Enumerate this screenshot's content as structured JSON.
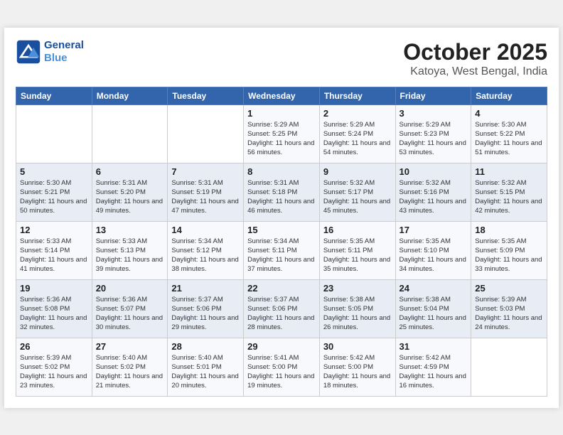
{
  "header": {
    "logo_line1": "General",
    "logo_line2": "Blue",
    "month": "October 2025",
    "location": "Katoya, West Bengal, India"
  },
  "weekdays": [
    "Sunday",
    "Monday",
    "Tuesday",
    "Wednesday",
    "Thursday",
    "Friday",
    "Saturday"
  ],
  "weeks": [
    [
      {
        "day": "",
        "info": ""
      },
      {
        "day": "",
        "info": ""
      },
      {
        "day": "",
        "info": ""
      },
      {
        "day": "1",
        "info": "Sunrise: 5:29 AM\nSunset: 5:25 PM\nDaylight: 11 hours\nand 56 minutes."
      },
      {
        "day": "2",
        "info": "Sunrise: 5:29 AM\nSunset: 5:24 PM\nDaylight: 11 hours\nand 54 minutes."
      },
      {
        "day": "3",
        "info": "Sunrise: 5:29 AM\nSunset: 5:23 PM\nDaylight: 11 hours\nand 53 minutes."
      },
      {
        "day": "4",
        "info": "Sunrise: 5:30 AM\nSunset: 5:22 PM\nDaylight: 11 hours\nand 51 minutes."
      }
    ],
    [
      {
        "day": "5",
        "info": "Sunrise: 5:30 AM\nSunset: 5:21 PM\nDaylight: 11 hours\nand 50 minutes."
      },
      {
        "day": "6",
        "info": "Sunrise: 5:31 AM\nSunset: 5:20 PM\nDaylight: 11 hours\nand 49 minutes."
      },
      {
        "day": "7",
        "info": "Sunrise: 5:31 AM\nSunset: 5:19 PM\nDaylight: 11 hours\nand 47 minutes."
      },
      {
        "day": "8",
        "info": "Sunrise: 5:31 AM\nSunset: 5:18 PM\nDaylight: 11 hours\nand 46 minutes."
      },
      {
        "day": "9",
        "info": "Sunrise: 5:32 AM\nSunset: 5:17 PM\nDaylight: 11 hours\nand 45 minutes."
      },
      {
        "day": "10",
        "info": "Sunrise: 5:32 AM\nSunset: 5:16 PM\nDaylight: 11 hours\nand 43 minutes."
      },
      {
        "day": "11",
        "info": "Sunrise: 5:32 AM\nSunset: 5:15 PM\nDaylight: 11 hours\nand 42 minutes."
      }
    ],
    [
      {
        "day": "12",
        "info": "Sunrise: 5:33 AM\nSunset: 5:14 PM\nDaylight: 11 hours\nand 41 minutes."
      },
      {
        "day": "13",
        "info": "Sunrise: 5:33 AM\nSunset: 5:13 PM\nDaylight: 11 hours\nand 39 minutes."
      },
      {
        "day": "14",
        "info": "Sunrise: 5:34 AM\nSunset: 5:12 PM\nDaylight: 11 hours\nand 38 minutes."
      },
      {
        "day": "15",
        "info": "Sunrise: 5:34 AM\nSunset: 5:11 PM\nDaylight: 11 hours\nand 37 minutes."
      },
      {
        "day": "16",
        "info": "Sunrise: 5:35 AM\nSunset: 5:11 PM\nDaylight: 11 hours\nand 35 minutes."
      },
      {
        "day": "17",
        "info": "Sunrise: 5:35 AM\nSunset: 5:10 PM\nDaylight: 11 hours\nand 34 minutes."
      },
      {
        "day": "18",
        "info": "Sunrise: 5:35 AM\nSunset: 5:09 PM\nDaylight: 11 hours\nand 33 minutes."
      }
    ],
    [
      {
        "day": "19",
        "info": "Sunrise: 5:36 AM\nSunset: 5:08 PM\nDaylight: 11 hours\nand 32 minutes."
      },
      {
        "day": "20",
        "info": "Sunrise: 5:36 AM\nSunset: 5:07 PM\nDaylight: 11 hours\nand 30 minutes."
      },
      {
        "day": "21",
        "info": "Sunrise: 5:37 AM\nSunset: 5:06 PM\nDaylight: 11 hours\nand 29 minutes."
      },
      {
        "day": "22",
        "info": "Sunrise: 5:37 AM\nSunset: 5:06 PM\nDaylight: 11 hours\nand 28 minutes."
      },
      {
        "day": "23",
        "info": "Sunrise: 5:38 AM\nSunset: 5:05 PM\nDaylight: 11 hours\nand 26 minutes."
      },
      {
        "day": "24",
        "info": "Sunrise: 5:38 AM\nSunset: 5:04 PM\nDaylight: 11 hours\nand 25 minutes."
      },
      {
        "day": "25",
        "info": "Sunrise: 5:39 AM\nSunset: 5:03 PM\nDaylight: 11 hours\nand 24 minutes."
      }
    ],
    [
      {
        "day": "26",
        "info": "Sunrise: 5:39 AM\nSunset: 5:02 PM\nDaylight: 11 hours\nand 23 minutes."
      },
      {
        "day": "27",
        "info": "Sunrise: 5:40 AM\nSunset: 5:02 PM\nDaylight: 11 hours\nand 21 minutes."
      },
      {
        "day": "28",
        "info": "Sunrise: 5:40 AM\nSunset: 5:01 PM\nDaylight: 11 hours\nand 20 minutes."
      },
      {
        "day": "29",
        "info": "Sunrise: 5:41 AM\nSunset: 5:00 PM\nDaylight: 11 hours\nand 19 minutes."
      },
      {
        "day": "30",
        "info": "Sunrise: 5:42 AM\nSunset: 5:00 PM\nDaylight: 11 hours\nand 18 minutes."
      },
      {
        "day": "31",
        "info": "Sunrise: 5:42 AM\nSunset: 4:59 PM\nDaylight: 11 hours\nand 16 minutes."
      },
      {
        "day": "",
        "info": ""
      }
    ]
  ]
}
